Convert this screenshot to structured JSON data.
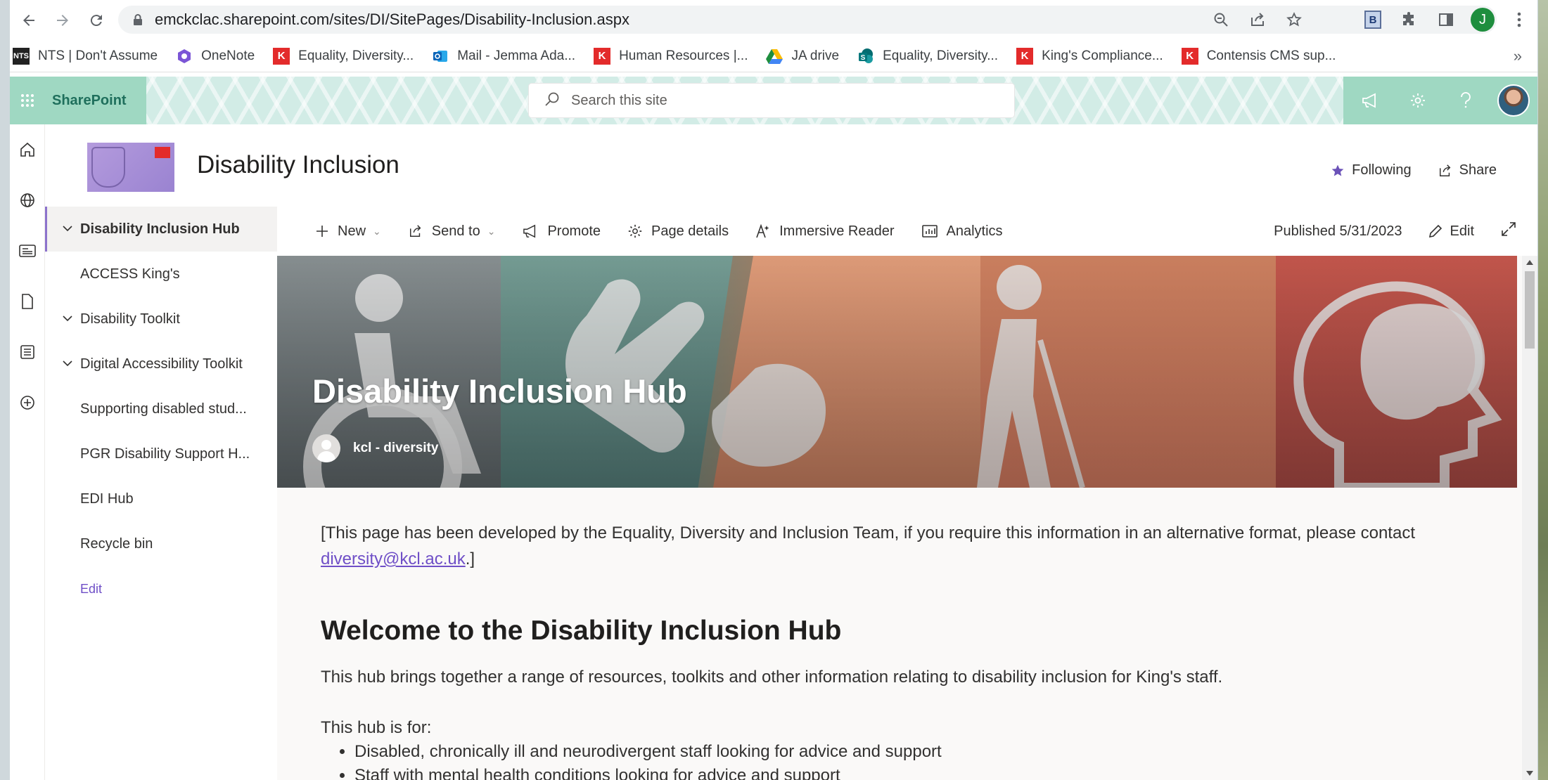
{
  "browser": {
    "url": "emckclac.sharepoint.com/sites/DI/SitePages/Disability-Inclusion.aspx",
    "profile_initial": "J",
    "extension_letter": "B"
  },
  "bookmarks": [
    {
      "label": "NTS | Don't Assume",
      "icon": "nts"
    },
    {
      "label": "OneNote",
      "icon": "onenote"
    },
    {
      "label": "Equality, Diversity...",
      "icon": "k"
    },
    {
      "label": "Mail - Jemma Ada...",
      "icon": "outlook"
    },
    {
      "label": "Human Resources |...",
      "icon": "k"
    },
    {
      "label": "JA drive",
      "icon": "drive"
    },
    {
      "label": "Equality, Diversity...",
      "icon": "sharepoint"
    },
    {
      "label": "King's Compliance...",
      "icon": "k"
    },
    {
      "label": "Contensis CMS sup...",
      "icon": "k"
    }
  ],
  "suite": {
    "brand": "SharePoint",
    "search_placeholder": "Search this site"
  },
  "site": {
    "title": "Disability Inclusion",
    "following_label": "Following",
    "share_label": "Share"
  },
  "nav": {
    "items": [
      {
        "label": "Disability Inclusion Hub",
        "expandable": true,
        "active": true
      },
      {
        "label": "ACCESS King's",
        "expandable": false
      },
      {
        "label": "Disability Toolkit",
        "expandable": true
      },
      {
        "label": "Digital Accessibility Toolkit",
        "expandable": true
      },
      {
        "label": "Supporting disabled stud...",
        "expandable": false
      },
      {
        "label": "PGR Disability Support H...",
        "expandable": false
      },
      {
        "label": "EDI Hub",
        "expandable": false
      },
      {
        "label": "Recycle bin",
        "expandable": false
      }
    ],
    "edit_label": "Edit"
  },
  "commandbar": {
    "new": "New",
    "send_to": "Send to",
    "promote": "Promote",
    "page_details": "Page details",
    "immersive_reader": "Immersive Reader",
    "analytics": "Analytics",
    "published": "Published 5/31/2023",
    "edit": "Edit"
  },
  "hero": {
    "title": "Disability Inclusion Hub",
    "author": "kcl - diversity"
  },
  "content": {
    "intro_before": "[This page has been developed by the Equality, Diversity and Inclusion Team, if you require this information in an alternative format, please contact ",
    "intro_link": "diversity@kcl.ac.uk",
    "intro_after": ".]",
    "welcome_heading": "Welcome to the Disability Inclusion Hub",
    "para1": "This hub brings together a range of resources, toolkits and other information relating to disability inclusion for King's staff.",
    "para2": "This hub is for:",
    "bullets": [
      "Disabled, chronically ill and neurodivergent staff looking for advice and support",
      "Staff with mental health conditions looking for advice and support"
    ]
  },
  "colors": {
    "accent": "#8c73cc",
    "suite_bg": "#9fd8c2",
    "brand_text": "#1f6f5c",
    "link": "#6f4fc7"
  }
}
